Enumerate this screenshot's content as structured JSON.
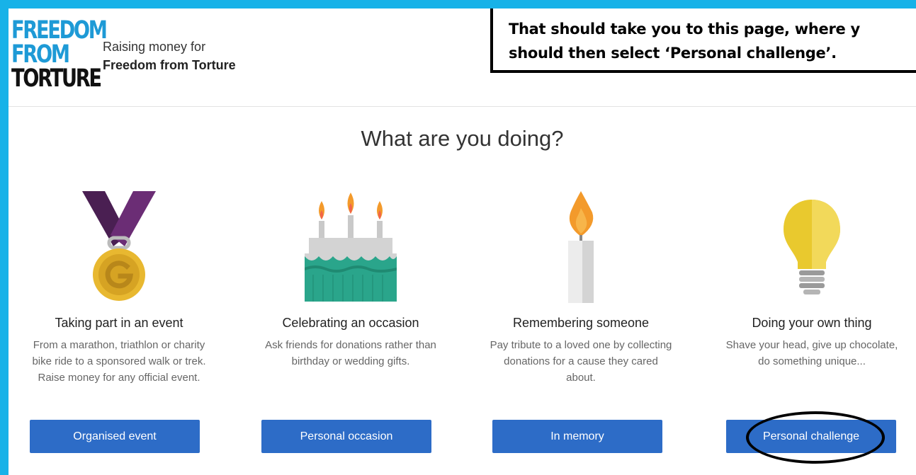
{
  "header": {
    "logo_lines": [
      "FREEDOM",
      "FROM",
      "TORTURE"
    ],
    "raising_label": "Raising money for",
    "charity_name": "Freedom from Torture"
  },
  "annotation": {
    "line1": "That should take you to this page, where y",
    "line2": "should then select ‘Personal challenge’."
  },
  "main": {
    "heading": "What are you doing?",
    "options": [
      {
        "icon": "medal-icon",
        "title": "Taking part in an event",
        "description": "From a marathon, triathlon or charity bike ride to a sponsored walk or trek. Raise money for any official event.",
        "button": "Organised event"
      },
      {
        "icon": "birthday-cake-icon",
        "title": "Celebrating an occasion",
        "description": "Ask friends for donations rather than birthday or wedding gifts.",
        "button": "Personal occasion"
      },
      {
        "icon": "candle-icon",
        "title": "Remembering someone",
        "description": "Pay tribute to a loved one by collecting donations for a cause they cared about.",
        "button": "In memory"
      },
      {
        "icon": "lightbulb-icon",
        "title": "Doing your own thing",
        "description": "Shave your head, give up chocolate, do something unique...",
        "button": "Personal challenge"
      }
    ]
  },
  "colors": {
    "background_border": "#17b2e8",
    "button": "#2d6cc7",
    "logo_blue": "#1e9ad6"
  }
}
